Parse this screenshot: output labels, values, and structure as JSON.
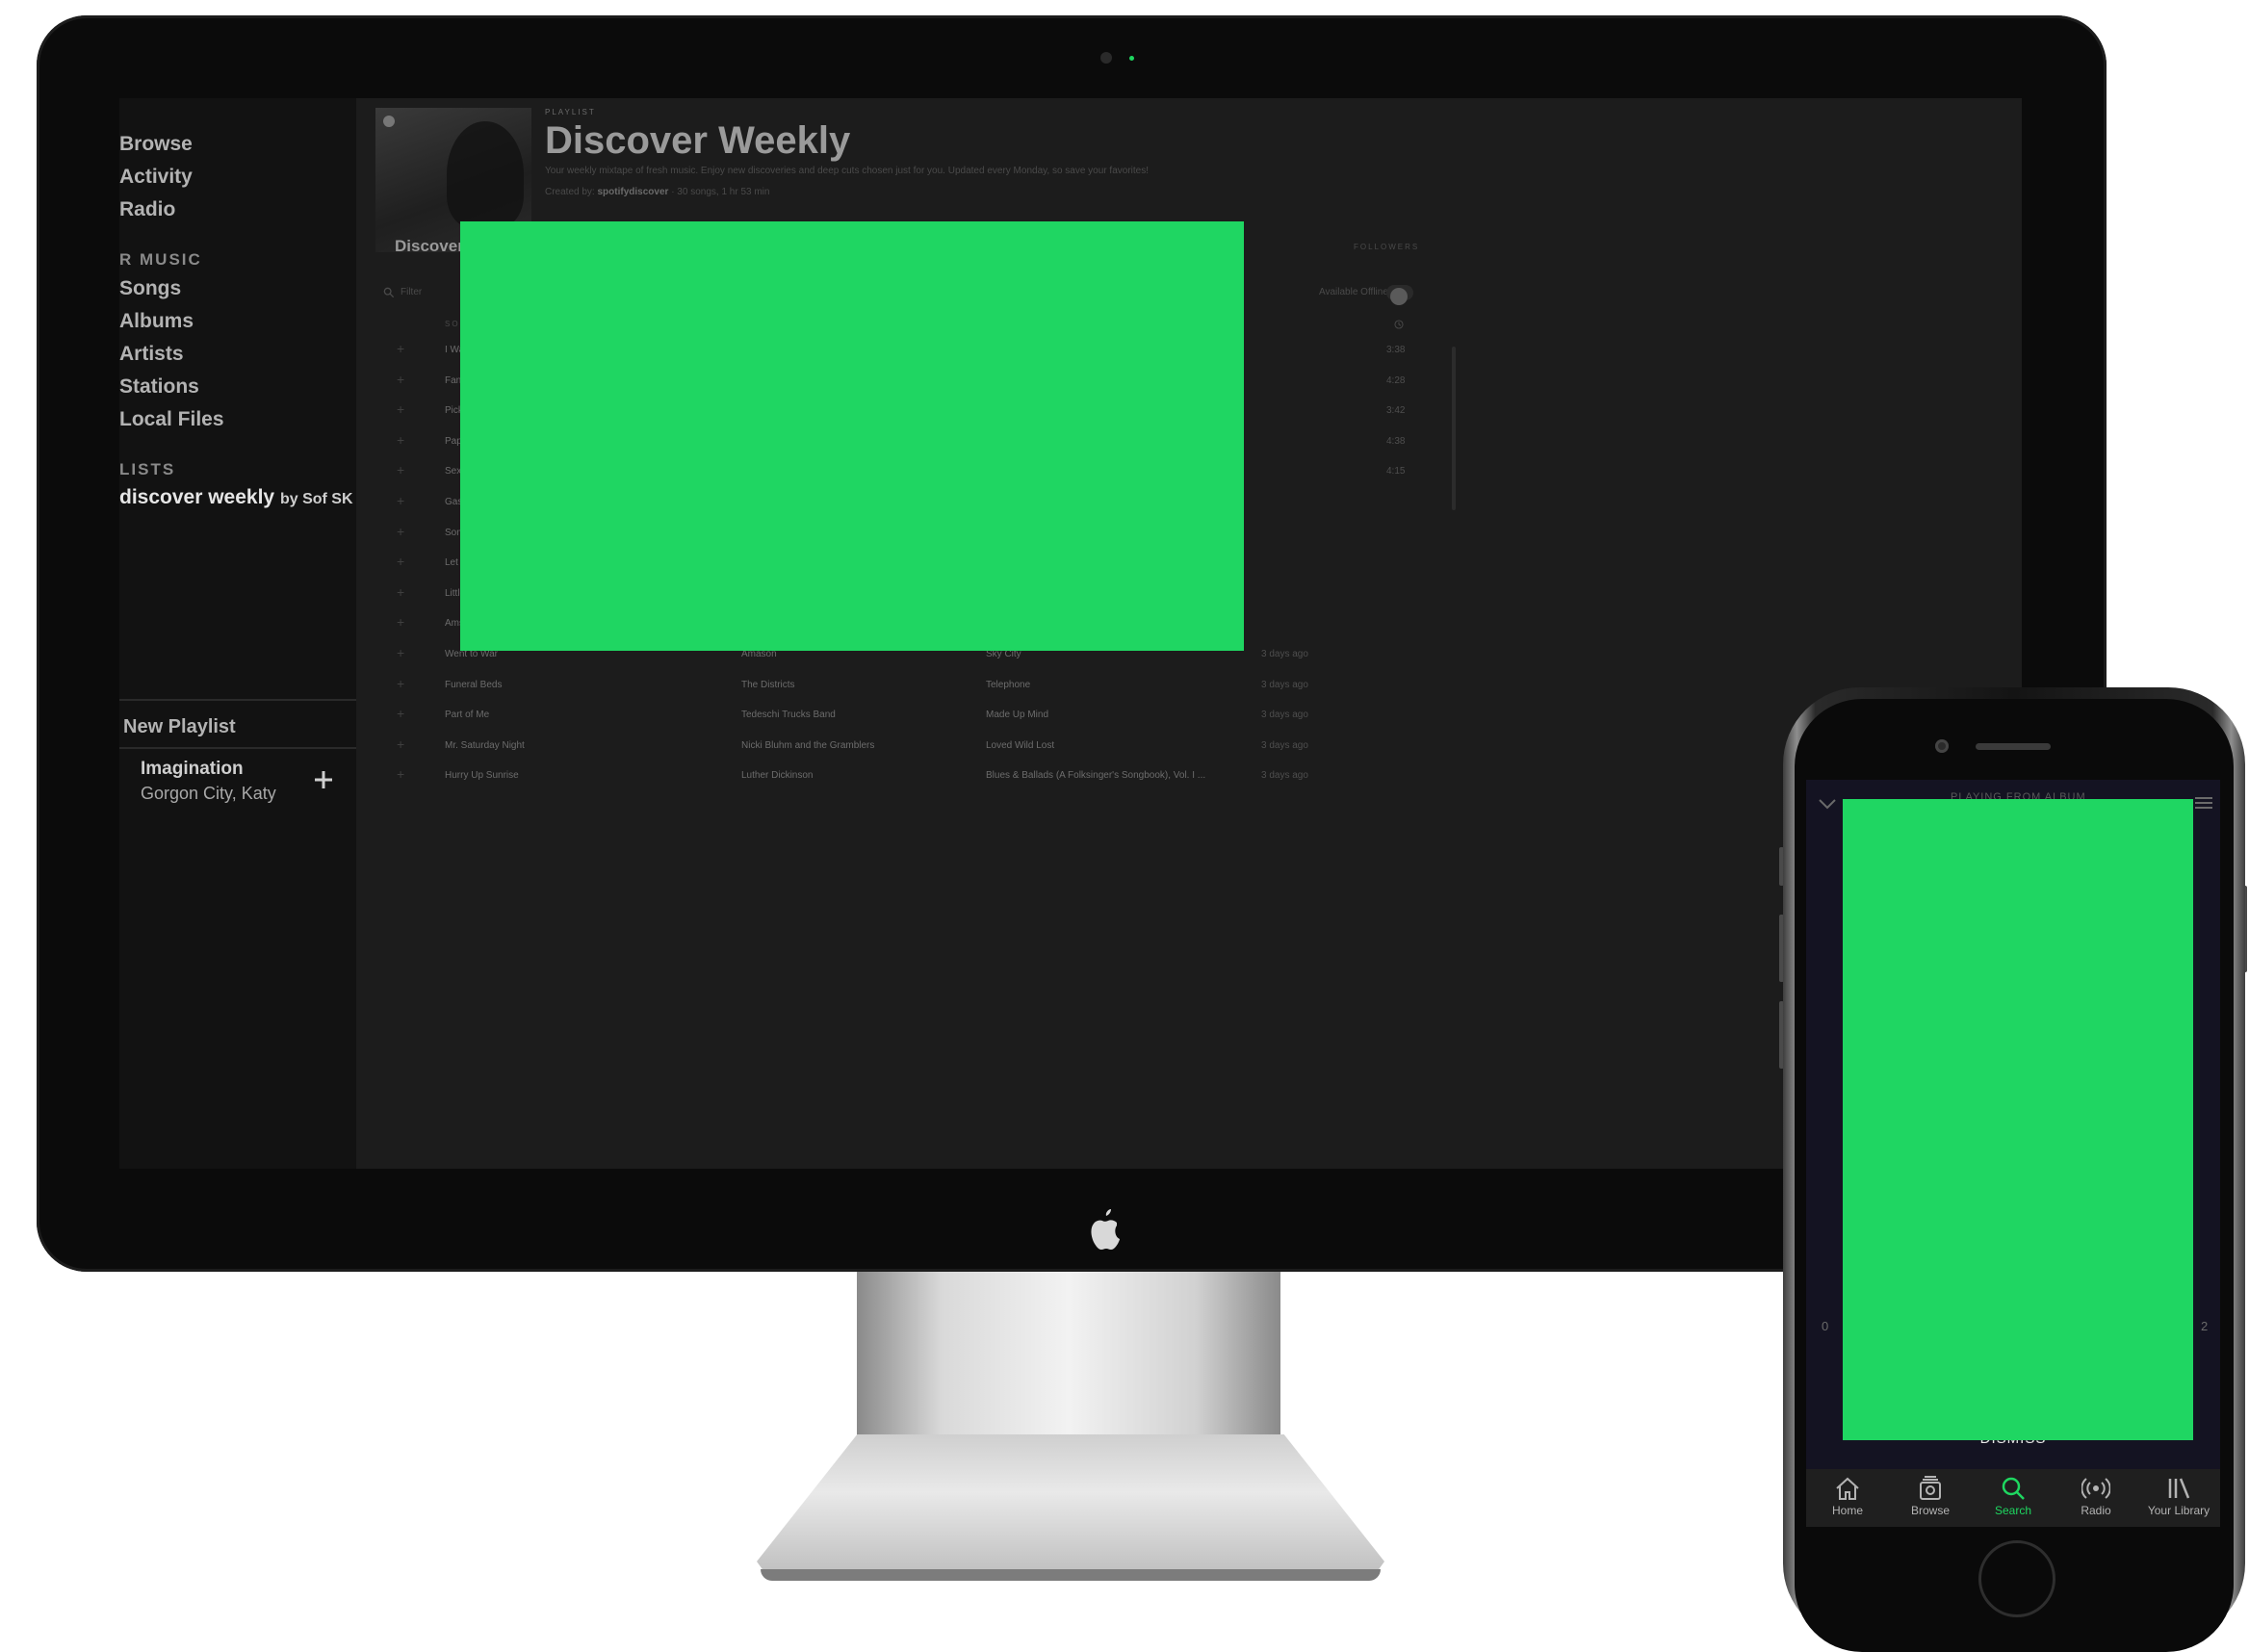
{
  "desktop": {
    "sidebar": {
      "nav": [
        "Browse",
        "Activity",
        "Radio"
      ],
      "your_music_title": "R MUSIC",
      "music_items": [
        "Songs",
        "Albums",
        "Artists",
        "Stations",
        "Local Files"
      ],
      "playlists_title": "LISTS",
      "playlist": {
        "name": "discover weekly",
        "by": "by Sof SK"
      },
      "new_playlist": "New Playlist",
      "now_playing": {
        "title": "Imagination",
        "artist": "Gorgon City, Katy"
      }
    },
    "playlist": {
      "label": "PLAYLIST",
      "cover_title": "Discover Weekly",
      "title": "Discover Weekly",
      "description": "Your weekly mixtape of fresh music. Enjoy new discoveries and deep cuts chosen just for you. Updated every Monday, so save your favorites!",
      "created_by_label": "Created by:",
      "created_by": "spotifydiscover",
      "stats": "· 30 songs, 1 hr 53 min",
      "followers_label": "FOLLOWERS",
      "filter_placeholder": "Filter",
      "offline_label": "Available Offline",
      "song_column": "SONG"
    },
    "tracks": [
      {
        "title": "I Was Made to Love",
        "artist": "",
        "album": "",
        "added": "",
        "duration": "3:38"
      },
      {
        "title": "Fanfare",
        "artist": "",
        "album": "",
        "added": "",
        "duration": "4:28"
      },
      {
        "title": "Pick You Up",
        "artist": "",
        "album": "",
        "added": "",
        "duration": "3:42"
      },
      {
        "title": "Papa Dukie And The",
        "artist": "",
        "album": "",
        "added": "",
        "duration": "4:38"
      },
      {
        "title": "Sexy Weekend",
        "artist": "",
        "album": "",
        "added": "",
        "duration": "4:15"
      },
      {
        "title": "Gasoline",
        "artist": "",
        "album": "",
        "added": "",
        "duration": ""
      },
      {
        "title": "Somebody Was Wa",
        "artist": "",
        "album": "",
        "added": "",
        "duration": ""
      },
      {
        "title": "Let 'Em In",
        "artist": "",
        "album": "",
        "added": "",
        "duration": ""
      },
      {
        "title": "Little Girl",
        "artist": "",
        "album": "",
        "added": "",
        "duration": ""
      },
      {
        "title": "Amsterdam",
        "artist": "",
        "album": "",
        "added": "",
        "duration": ""
      },
      {
        "title": "Went to War",
        "artist": "Amason",
        "album": "Sky City",
        "added": "3 days ago",
        "duration": ""
      },
      {
        "title": "Funeral Beds",
        "artist": "The Districts",
        "album": "Telephone",
        "added": "3 days ago",
        "duration": ""
      },
      {
        "title": "Part of Me",
        "artist": "Tedeschi Trucks Band",
        "album": "Made Up Mind",
        "added": "3 days ago",
        "duration": ""
      },
      {
        "title": "Mr. Saturday Night",
        "artist": "Nicki Bluhm and the Gramblers",
        "album": "Loved Wild Lost",
        "added": "3 days ago",
        "duration": ""
      },
      {
        "title": "Hurry Up Sunrise",
        "artist": "Luther Dickinson",
        "album": "Blues & Ballads (A Folksinger's Songbook), Vol. I ...",
        "added": "3 days ago",
        "duration": ""
      }
    ]
  },
  "mobile": {
    "playing_from": "PLAYING FROM ALBUM",
    "time_start": "0",
    "time_end": "2",
    "dismiss": "DISMISS",
    "tabs": [
      {
        "label": "Home",
        "icon": "home-icon",
        "active": false
      },
      {
        "label": "Browse",
        "icon": "browse-icon",
        "active": false
      },
      {
        "label": "Search",
        "icon": "search-icon",
        "active": true
      },
      {
        "label": "Radio",
        "icon": "radio-icon",
        "active": false
      },
      {
        "label": "Your Library",
        "icon": "library-icon",
        "active": false
      }
    ]
  },
  "colors": {
    "accent": "#1ed760",
    "placeholder": "#1fd662"
  }
}
